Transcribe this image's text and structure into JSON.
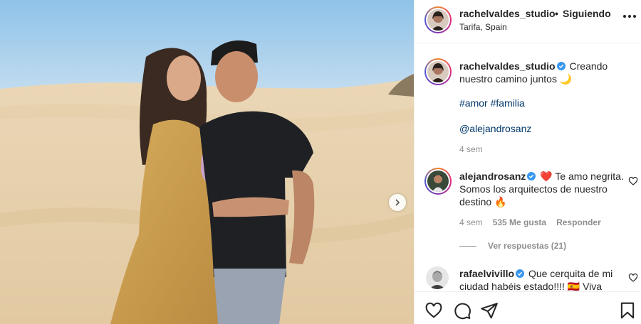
{
  "post": {
    "author": "rachelvaldes_studio",
    "separator": "•",
    "follow_status": "Siguiendo",
    "location": "Tarifa, Spain"
  },
  "caption": {
    "username": "rachelvaldes_studio",
    "text": "Creando nuestro camino juntos 🌙",
    "hashtags": "#amor #familia",
    "mention": "@alejandrosanz",
    "time": "4 sem"
  },
  "comments": [
    {
      "username": "alejandrosanz",
      "text": "❤️ Te amo negrita. Somos los arquitectos de nuestro destino 🔥",
      "time": "4 sem",
      "likes": "535 Me gusta",
      "reply_label": "Responder",
      "view_replies": "Ver respuestas (21)"
    },
    {
      "username": "rafaelvivillo",
      "text": "Que cerquita de mi ciudad habéis estado!!!! 🇪🇸 Viva"
    }
  ],
  "icons": {
    "like": "heart-icon",
    "comment": "comment-icon",
    "share": "paper-plane-icon",
    "save": "bookmark-icon",
    "more": "more-options-icon",
    "next": "chevron-right-icon",
    "verified": "verified-badge-icon"
  },
  "colors": {
    "verified_blue": "#3897f0",
    "link_blue": "#00376b",
    "muted": "#8e8e8e",
    "text": "#262626"
  }
}
